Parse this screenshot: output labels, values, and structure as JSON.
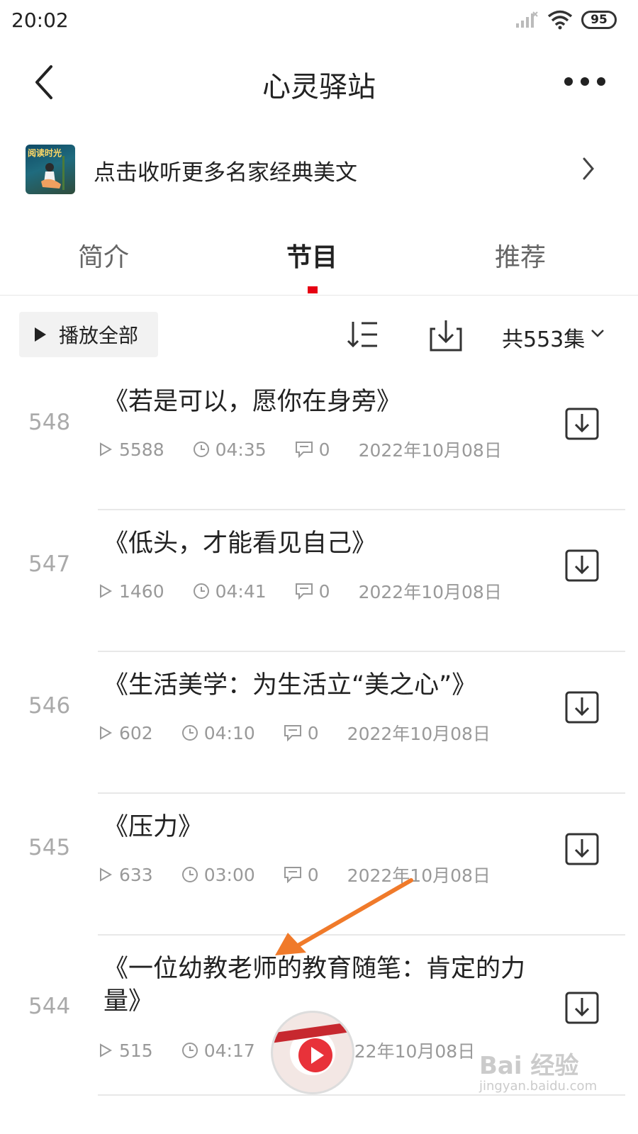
{
  "status_bar": {
    "time": "20:02",
    "battery": "95"
  },
  "header": {
    "title": "心灵驿站"
  },
  "promo": {
    "thumb_text": "阅读时光",
    "text": "点击收听更多名家经典美文"
  },
  "tabs": [
    {
      "label": "简介",
      "active": false
    },
    {
      "label": "节目",
      "active": true
    },
    {
      "label": "推荐",
      "active": false
    }
  ],
  "toolbar": {
    "play_all": "播放全部",
    "count": "共553集"
  },
  "episodes": [
    {
      "num": "548",
      "title": "《若是可以，愿你在身旁》",
      "plays": "5588",
      "duration": "04:35",
      "comments": "0",
      "date": "2022年10月08日"
    },
    {
      "num": "547",
      "title": "《低头，才能看见自己》",
      "plays": "1460",
      "duration": "04:41",
      "comments": "0",
      "date": "2022年10月08日"
    },
    {
      "num": "546",
      "title": "《生活美学：为生活立“美之心”》",
      "plays": "602",
      "duration": "04:10",
      "comments": "0",
      "date": "2022年10月08日"
    },
    {
      "num": "545",
      "title": "《压力》",
      "plays": "633",
      "duration": "03:00",
      "comments": "0",
      "date": "2022年10月08日"
    },
    {
      "num": "544",
      "title": "《一位幼教老师的教育随笔：肯定的力量》",
      "plays": "515",
      "duration": "04:17",
      "comments": "",
      "date": "22年10月08日"
    }
  ],
  "watermark": {
    "main": "Bai 经验",
    "sub": "jingyan.baidu.com"
  },
  "colors": {
    "accent": "#e60012",
    "annotation": "#f07a2a"
  }
}
